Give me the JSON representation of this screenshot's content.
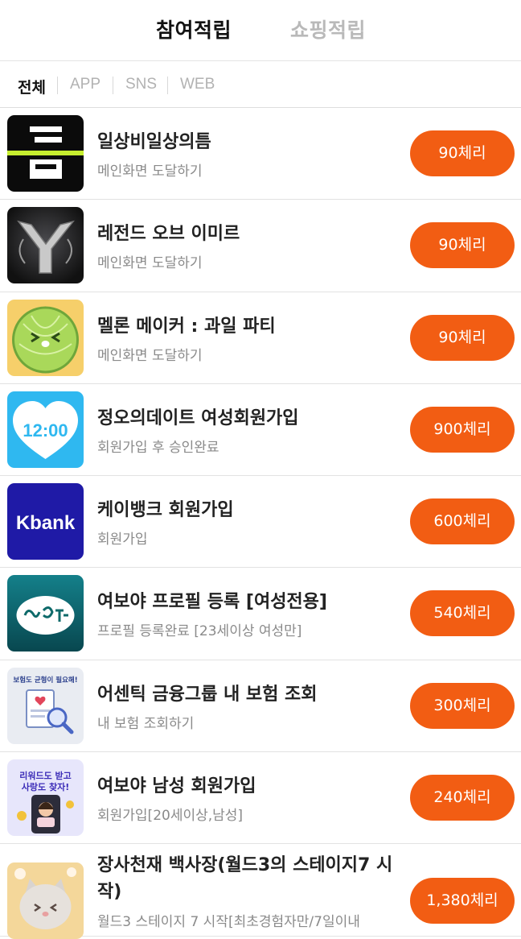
{
  "top_tabs": {
    "active": "참여적립",
    "inactive": "쇼핑적립"
  },
  "filters": [
    "전체",
    "APP",
    "SNS",
    "WEB"
  ],
  "thumb_text": {
    "bank": "Kbank",
    "clock": "12:00",
    "insurance": "보험도 균형이 필요해!",
    "promo_line1": "리워드도 받고",
    "promo_line2": "사랑도 찾자!"
  },
  "items": [
    {
      "title": "일상비일상의틈",
      "subtitle": "메인화면 도달하기",
      "reward": "90체리",
      "icon": "teum-app-icon"
    },
    {
      "title": "레전드 오브 이미르",
      "subtitle": "메인화면 도달하기",
      "reward": "90체리",
      "icon": "ymir-game-icon"
    },
    {
      "title": "멜론 메이커 : 과일 파티",
      "subtitle": "메인화면 도달하기",
      "reward": "90체리",
      "icon": "melon-game-icon"
    },
    {
      "title": "정오의데이트 여성회원가입",
      "subtitle": "회원가입 후 승인완료",
      "reward": "900체리",
      "icon": "noon-date-icon"
    },
    {
      "title": "케이뱅크 회원가입",
      "subtitle": "회원가입",
      "reward": "600체리",
      "icon": "kbank-icon"
    },
    {
      "title": "여보야 프로필 등록 [여성전용]",
      "subtitle": "프로필 등록완료 [23세이상 여성만]",
      "reward": "540체리",
      "icon": "yeoboya-icon"
    },
    {
      "title": "어센틱 금융그룹 내 보험 조회",
      "subtitle": "내 보험 조회하기",
      "reward": "300체리",
      "icon": "insurance-icon"
    },
    {
      "title": "여보야 남성 회원가입",
      "subtitle": "회원가입[20세이상,남성]",
      "reward": "240체리",
      "icon": "yeoboya-promo-icon"
    },
    {
      "title": "장사천재 백사장(월드3의 스테이지7 시작)",
      "subtitle": "월드3 스테이지 7 시작[최초경험자만/7일이내",
      "reward": "1,380체리",
      "icon": "cat-game-icon"
    }
  ],
  "colors": {
    "accent": "#f25d13",
    "kbank": "#1f1aa6",
    "noon_date": "#2fb8f0",
    "yeoboya": "#0e6a6a"
  }
}
